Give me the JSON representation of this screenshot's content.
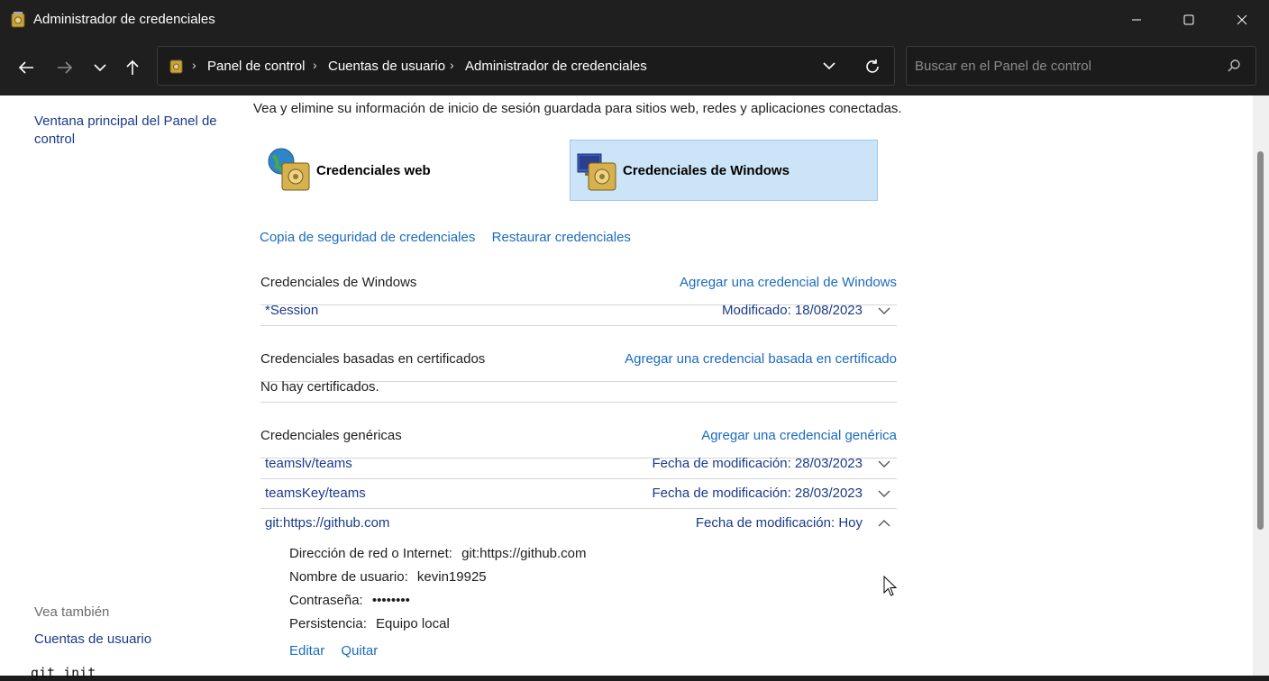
{
  "window": {
    "title": "Administrador de credenciales",
    "minimize_icon": "minimize-icon",
    "maximize_icon": "maximize-icon",
    "close_icon": "close-icon"
  },
  "navigation": {
    "breadcrumb": [
      "Panel de control",
      "Cuentas de usuario",
      "Administrador de credenciales"
    ],
    "search_placeholder": "Buscar en el Panel de control"
  },
  "sidebar": {
    "home_link": "Ventana principal del Panel de control",
    "see_also_heading": "Vea también",
    "see_also_link": "Cuentas de usuario"
  },
  "main": {
    "intro": "Vea y elimine su información de inicio de sesión guardada para sitios web, redes y aplicaciones conectadas.",
    "categories": [
      {
        "label": "Credenciales web",
        "selected": false
      },
      {
        "label": "Credenciales de Windows",
        "selected": true
      }
    ],
    "backup_link": "Copia de seguridad de credenciales",
    "restore_link": "Restaurar credenciales",
    "windows_section": {
      "label": "Credenciales de Windows",
      "add": "Agregar una credencial de Windows",
      "items": [
        {
          "name": "*Session",
          "meta_label": "Modificado:",
          "meta_value": "18/08/2023"
        }
      ]
    },
    "cert_section": {
      "label": "Credenciales basadas en certificados",
      "add": "Agregar una credencial basada en certificado",
      "empty": "No hay certificados."
    },
    "generic_section": {
      "label": "Credenciales genéricas",
      "add": "Agregar una credencial genérica",
      "items": [
        {
          "name": "teamslv/teams",
          "meta_label": "Fecha de modificación:",
          "meta_value": "28/03/2023"
        },
        {
          "name": "teamsKey/teams",
          "meta_label": "Fecha de modificación:",
          "meta_value": "28/03/2023"
        },
        {
          "name": "git:https://github.com",
          "meta_label": "Fecha de modificación:",
          "meta_value": "Hoy"
        }
      ]
    },
    "expanded": {
      "address_label": "Dirección de red o Internet:",
      "address_value": "git:https://github.com",
      "user_label": "Nombre de usuario:",
      "user_value": "kevin19925",
      "password_label": "Contraseña:",
      "password_value": "••••••••",
      "persistence_label": "Persistencia:",
      "persistence_value": "Equipo local",
      "edit": "Editar",
      "remove": "Quitar"
    }
  },
  "background_terminal_text": "git init"
}
